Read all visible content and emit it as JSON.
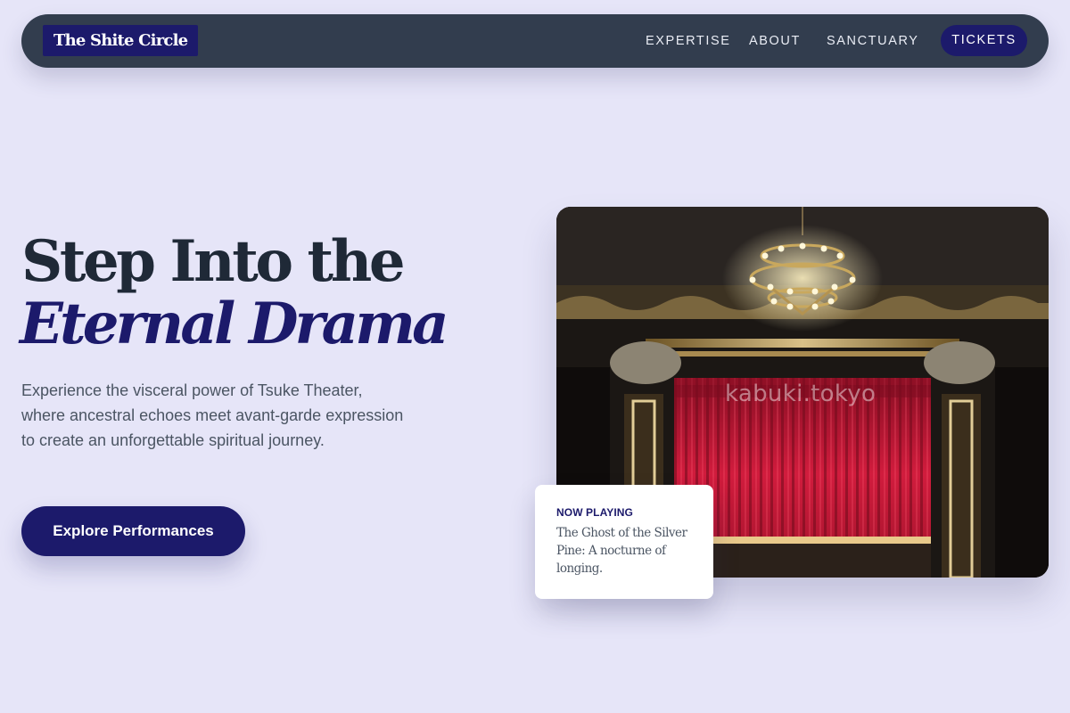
{
  "header": {
    "logo_text": "The Shite Circle",
    "nav": [
      {
        "label": "EXPERTISE"
      },
      {
        "label": "ABOUT"
      },
      {
        "label": "SANCTUARY"
      }
    ],
    "tickets_label": "TICKETS"
  },
  "hero": {
    "title_line1": "Step Into the",
    "title_line2": "Eternal Drama",
    "description": "Experience the visceral power of Tsuke Theater, where ancestral echoes meet avant-garde expression to create an unforgettable spiritual journey.",
    "cta_label": "Explore Performances"
  },
  "image": {
    "watermark": "kabuki.tokyo"
  },
  "now_playing": {
    "label": "NOW PLAYING",
    "text": "The Ghost of the Silver Pine: A nocturne of longing."
  },
  "colors": {
    "background": "#e6e5f8",
    "nav_background": "#323d4e",
    "accent": "#1c1a6b",
    "heading": "#1f2937",
    "body_text": "#4b5563",
    "curtain": "#c81e3a"
  }
}
